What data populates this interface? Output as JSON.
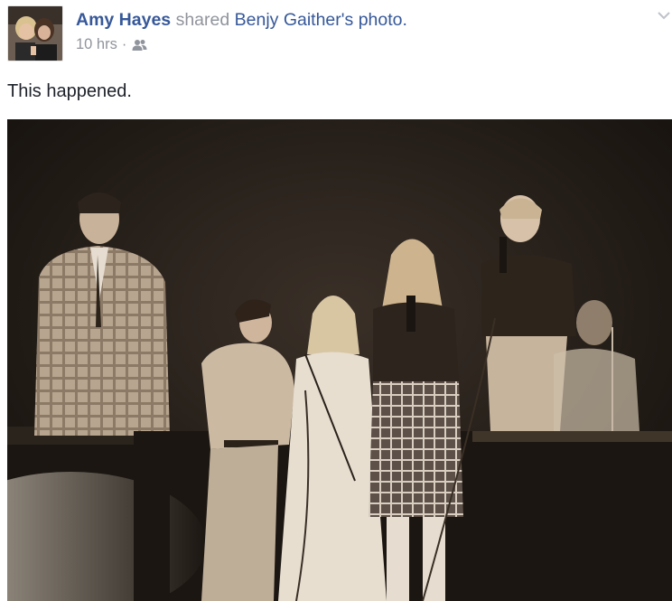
{
  "post": {
    "actor_name": "Amy Hayes",
    "action_text": "shared",
    "source_owner": "Benjy Gaither",
    "source_possessive": "'s",
    "source_object": "photo",
    "period": ".",
    "timestamp": "10 hrs",
    "separator": "·",
    "audience_icon": "friends-icon",
    "menu_icon": "chevron-down-icon",
    "message": "This happened."
  },
  "photo": {
    "description_icon": "vintage-stage-photo",
    "tone": "sepia"
  },
  "colors": {
    "link": "#365899",
    "meta": "#90949c",
    "text": "#1d2129"
  }
}
